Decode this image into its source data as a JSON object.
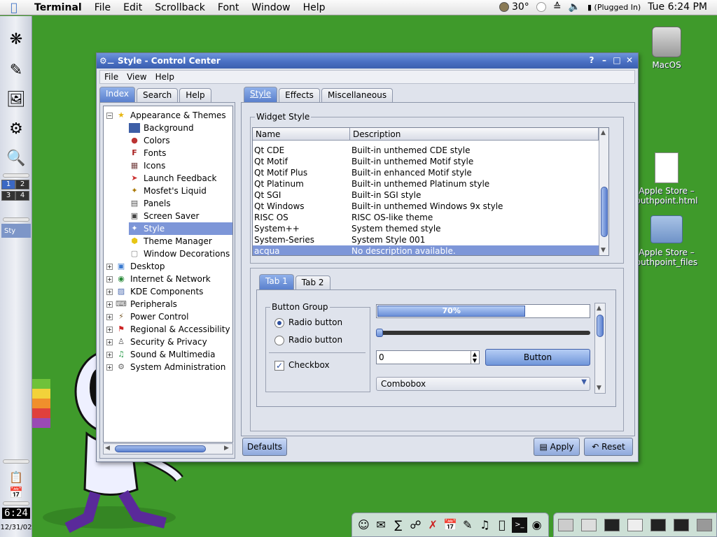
{
  "menubar": {
    "app": "Terminal",
    "items": [
      "File",
      "Edit",
      "Scrollback",
      "Font",
      "Window",
      "Help"
    ],
    "temperature": "30°",
    "power": "(Plugged In)",
    "clock": "Tue 6:24 PM"
  },
  "kicker": {
    "pager": [
      "1",
      "2",
      "3",
      "4"
    ],
    "task_label": "Sty",
    "clock": "6:24",
    "date": "12/31/02"
  },
  "desktop": {
    "icons": [
      "MacOS",
      "Apple Store – outhpoint.html",
      "Apple Store – outhpoint_files"
    ]
  },
  "window": {
    "title": "Style - Control Center",
    "menu": [
      "File",
      "View",
      "Help"
    ],
    "left_tabs": [
      "Index",
      "Search",
      "Help"
    ],
    "tree": [
      {
        "label": "Appearance & Themes",
        "level": 0,
        "expanded": true,
        "icon": "star-icon"
      },
      {
        "label": "Background",
        "level": 1,
        "icon": "background-icon"
      },
      {
        "label": "Colors",
        "level": 1,
        "icon": "colors-icon"
      },
      {
        "label": "Fonts",
        "level": 1,
        "icon": "fonts-icon"
      },
      {
        "label": "Icons",
        "level": 1,
        "icon": "icons-icon"
      },
      {
        "label": "Launch Feedback",
        "level": 1,
        "icon": "rocket-icon"
      },
      {
        "label": "Mosfet's Liquid",
        "level": 1,
        "icon": "liquid-icon"
      },
      {
        "label": "Panels",
        "level": 1,
        "icon": "panels-icon"
      },
      {
        "label": "Screen Saver",
        "level": 1,
        "icon": "screensaver-icon"
      },
      {
        "label": "Style",
        "level": 1,
        "selected": true,
        "icon": "style-icon"
      },
      {
        "label": "Theme Manager",
        "level": 1,
        "icon": "theme-icon"
      },
      {
        "label": "Window Decorations",
        "level": 1,
        "icon": "window-decorations-icon"
      },
      {
        "label": "Desktop",
        "level": 0,
        "icon": "desktop-icon"
      },
      {
        "label": "Internet & Network",
        "level": 0,
        "icon": "globe-icon"
      },
      {
        "label": "KDE Components",
        "level": 0,
        "icon": "components-icon"
      },
      {
        "label": "Peripherals",
        "level": 0,
        "icon": "peripherals-icon"
      },
      {
        "label": "Power Control",
        "level": 0,
        "icon": "power-icon"
      },
      {
        "label": "Regional & Accessibility",
        "level": 0,
        "icon": "flag-icon"
      },
      {
        "label": "Security & Privacy",
        "level": 0,
        "icon": "security-icon"
      },
      {
        "label": "Sound & Multimedia",
        "level": 0,
        "icon": "sound-icon"
      },
      {
        "label": "System Administration",
        "level": 0,
        "icon": "sysadmin-icon"
      }
    ],
    "right_tabs": [
      "Style",
      "Effects",
      "Miscellaneous"
    ],
    "widget_style": {
      "title": "Widget Style",
      "columns": [
        "Name",
        "Description"
      ],
      "rows": [
        {
          "name": "Qt CDE",
          "desc": "Built-in unthemed CDE style"
        },
        {
          "name": "Qt Motif",
          "desc": "Built-in unthemed Motif style"
        },
        {
          "name": "Qt Motif Plus",
          "desc": "Built-in enhanced Motif style"
        },
        {
          "name": "Qt Platinum",
          "desc": "Built-in unthemed Platinum style"
        },
        {
          "name": "Qt SGI",
          "desc": "Built-in SGI style"
        },
        {
          "name": "Qt Windows",
          "desc": "Built-in unthemed Windows 9x style"
        },
        {
          "name": "RISC OS",
          "desc": "RISC OS-like theme"
        },
        {
          "name": "System++",
          "desc": "System themed style"
        },
        {
          "name": "System-Series",
          "desc": "System Style 001"
        },
        {
          "name": "acqua",
          "desc": "No description available.",
          "selected": true
        }
      ]
    },
    "preview": {
      "tabs": [
        "Tab 1",
        "Tab 2"
      ],
      "button_group_title": "Button Group",
      "radio1": "Radio button",
      "radio2": "Radio button",
      "radio1_checked": true,
      "checkbox": "Checkbox",
      "checkbox_checked": true,
      "progress": 70,
      "progress_label": "70%",
      "slider_value": 0,
      "spin_value": "0",
      "button": "Button",
      "combobox": "Combobox"
    },
    "buttons": {
      "defaults": "Defaults",
      "apply": "Apply",
      "reset": "Reset"
    }
  }
}
